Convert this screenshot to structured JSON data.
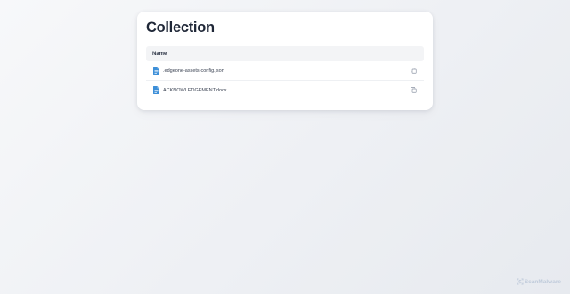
{
  "page": {
    "title": "Collection"
  },
  "table": {
    "header": {
      "name": "Name"
    },
    "rows": [
      {
        "name": ".edgeone-assets-config.json",
        "icon": "file-document-icon"
      },
      {
        "name": "ACKNOWLEDGEMENT.docx",
        "icon": "file-document-icon"
      }
    ]
  },
  "watermark": {
    "text": "ScanMalware",
    "icon": "scanmalware-logo-icon"
  },
  "colors": {
    "file_icon": "#3d8fd8",
    "title": "#1f2737",
    "header_bg": "#f3f4f6",
    "watermark": "#c0cbdb"
  }
}
